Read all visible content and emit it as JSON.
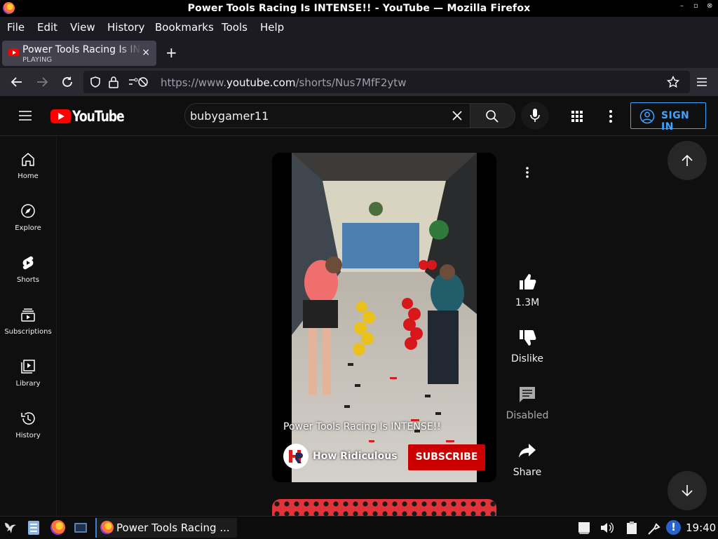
{
  "window": {
    "title": "Power Tools Racing Is INTENSE!! - YouTube — Mozilla Firefox",
    "controls": [
      "–",
      "▫",
      "⊗"
    ]
  },
  "menu": [
    "File",
    "Edit",
    "View",
    "History",
    "Bookmarks",
    "Tools",
    "Help"
  ],
  "tab": {
    "title": "Power Tools Racing Is INTENSE!! - YouTube",
    "status": "PLAYING",
    "close": "×"
  },
  "newtab": "+",
  "url": {
    "prefix": "https://www.",
    "domain": "youtube.com",
    "path": "/shorts/Nus7MfF2ytw"
  },
  "youtube": {
    "logo_text": "YouTube",
    "search_value": "bubygamer11",
    "sign_in": "SIGN IN",
    "sidebar": [
      {
        "label": "Home",
        "icon": "home-icon"
      },
      {
        "label": "Explore",
        "icon": "compass-icon"
      },
      {
        "label": "Shorts",
        "icon": "shorts-icon"
      },
      {
        "label": "Subscriptions",
        "icon": "subscriptions-icon"
      },
      {
        "label": "Library",
        "icon": "library-icon"
      },
      {
        "label": "History",
        "icon": "history-icon"
      }
    ],
    "short": {
      "title": "Power Tools Racing Is INTENSE!!",
      "channel": "How Ridiculous",
      "subscribe": "SUBSCRIBE"
    },
    "actions": {
      "likes": "1.3M",
      "dislike": "Dislike",
      "comments": "Disabled",
      "share": "Share"
    }
  },
  "taskbar": {
    "app": "Power Tools Racing ...",
    "clock": "19:40"
  },
  "colors": {
    "yt_red": "#ff0000",
    "subscribe_red": "#cc0000",
    "signin_blue": "#3ea6ff",
    "firefox_chrome": "#2b2a33"
  }
}
